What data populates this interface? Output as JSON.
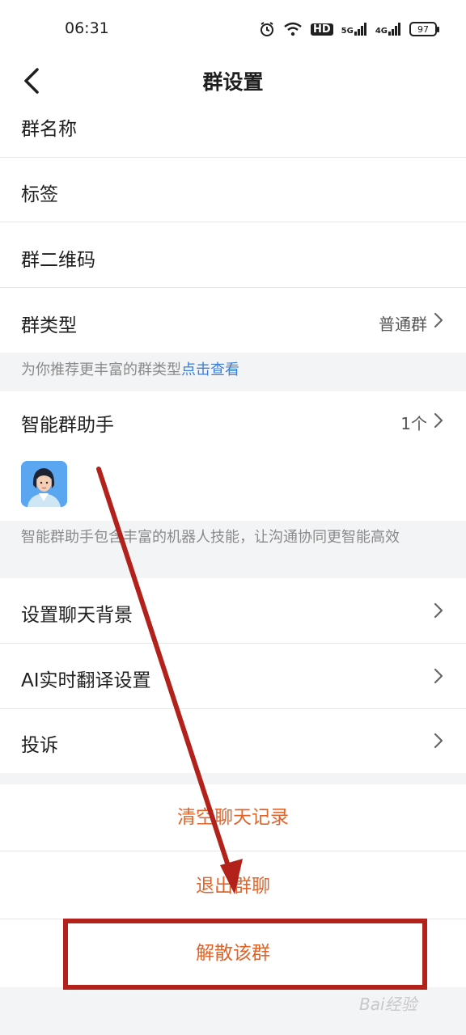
{
  "status": {
    "time": "06:31",
    "hd": "HD",
    "sig5g": "5G",
    "sig4g": "4G",
    "battery": "97"
  },
  "nav": {
    "title": "群设置"
  },
  "rows": {
    "group_name": {
      "label": "群名称"
    },
    "tags": {
      "label": "标签"
    },
    "qr": {
      "label": "群二维码"
    },
    "group_type": {
      "label": "群类型",
      "value": "普通群"
    }
  },
  "type_hint": {
    "text": "为你推荐更丰富的群类型",
    "link": "点击查看"
  },
  "assistant": {
    "label": "智能群助手",
    "value": "1个",
    "hint": "智能群助手包含丰富的机器人技能，让沟通协同更智能高效"
  },
  "settings": {
    "background": {
      "label": "设置聊天背景"
    },
    "translate": {
      "label": "AI实时翻译设置"
    },
    "report": {
      "label": "投诉"
    }
  },
  "actions": {
    "clear": "清空聊天记录",
    "quit": "退出群聊",
    "dissolve": "解散该群"
  },
  "watermark": {
    "text": "Bai经验"
  },
  "colors": {
    "accent_link": "#3b7ed6",
    "danger_text": "#e0652c",
    "annotation": "#b3211b"
  }
}
